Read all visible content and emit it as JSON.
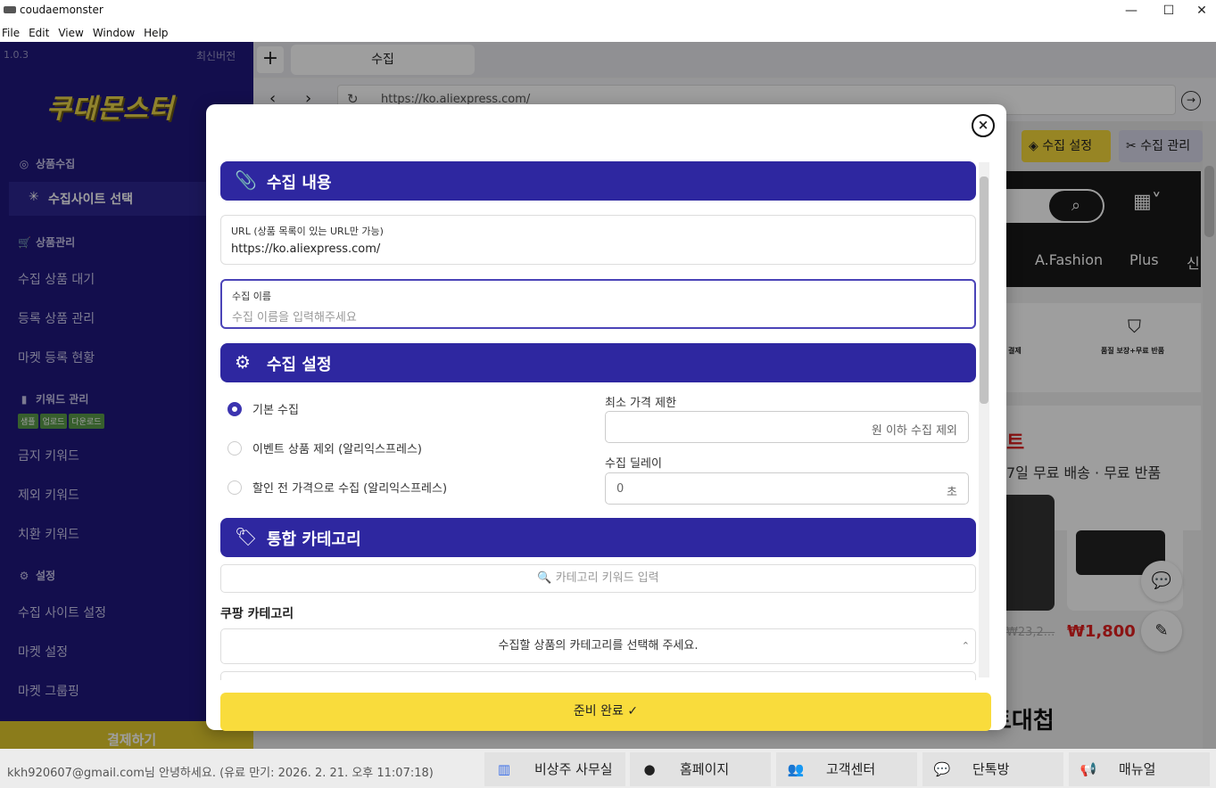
{
  "window": {
    "title": "coudaemonster",
    "minimize": "—",
    "maximize": "☐",
    "close": "✕"
  },
  "menu": [
    "File",
    "Edit",
    "View",
    "Window",
    "Help"
  ],
  "sidebar": {
    "version": "1.0.3",
    "latest": "최신버전",
    "logo": "쿠대몬스터",
    "sections": {
      "collect": "상품수집",
      "site_select": "수집사이트 선택",
      "manage": "상품관리",
      "wait": "수집 상품 대기",
      "registered": "등록 상품 관리",
      "market_status": "마켓 등록 현황",
      "keyword": "키워드 관리",
      "tags": [
        "샘플",
        "업로드",
        "다운로드"
      ],
      "banned": "금지 키워드",
      "excluded": "제외 키워드",
      "replace": "치환 키워드",
      "settings": "설정",
      "site_settings": "수집 사이트 설정",
      "market_settings": "마켓 설정",
      "market_group": "마켓 그룹핑",
      "pay": "결제하기"
    }
  },
  "browser": {
    "new_tab": "+",
    "tab_label": "수집",
    "url": "https://ko.aliexpress.com/",
    "toolbar": {
      "collect_settings": "수집 설정",
      "collect_manage": "수집 관리"
    },
    "page": {
      "nav1": "A.Fashion",
      "nav2": "Plus",
      "nav3": "신",
      "feature1_title": "결제",
      "feature2_title": "품질 보장+무료 반품",
      "promo_title": "트",
      "promo_sub": "7일 무료 배송 · 무료 반품",
      "price": "₩1,800",
      "old_price": "₩23,2...",
      "bottom_text": "트대첩"
    }
  },
  "modal": {
    "section1": "수집 내용",
    "url_label": "URL (상품 목록이 있는 URL만 가능)",
    "url_value": "https://ko.aliexpress.com/",
    "name_label": "수집 이름",
    "name_placeholder": "수집 이름을 입력해주세요",
    "section2": "수집 설정",
    "radios": [
      "기본 수집",
      "이벤트 상품 제외 (알리익스프레스)",
      "할인 전 가격으로 수집 (알리익스프레스)"
    ],
    "min_price_label": "최소 가격 제한",
    "min_price_suffix": "원 이하 수집 제외",
    "delay_label": "수집 딜레이",
    "delay_value": "0",
    "delay_unit": "초",
    "section3": "통합 카테고리",
    "cat_search_placeholder": "🔍 카테고리 키워드 입력",
    "coupang_label": "쿠팡 카테고리",
    "cat_select": "수집할 상품의 카테고리를 선택해 주세요.",
    "ready": "준비 완료"
  },
  "status": {
    "text": "kkh920607@gmail.com님 안녕하세요. (유료 만기: 2026. 2. 21. 오후 11:07:18)",
    "buttons": [
      "비상주 사무실",
      "홈페이지",
      "고객센터",
      "단톡방",
      "매뉴얼"
    ]
  },
  "colors": {
    "sidebar": "#20187c",
    "band": "#2e27a0",
    "ready": "#f9dc3c",
    "accent": "#3c34b0"
  }
}
